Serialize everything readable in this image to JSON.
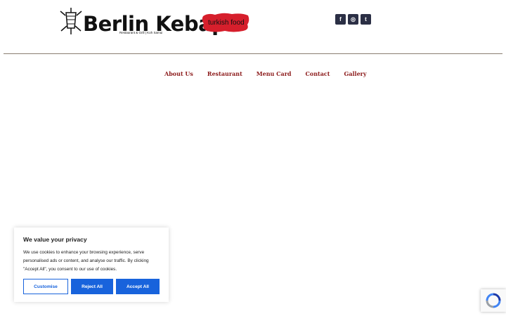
{
  "header": {
    "brand_name": "Berlin Kebap",
    "tagline": "Restaurant & Grill | Koh Samui",
    "badge_text": "turkish food",
    "badge_color": "#d61f2c"
  },
  "social": [
    {
      "icon": "facebook-icon",
      "glyph": "f"
    },
    {
      "icon": "instagram-icon",
      "glyph": "◎"
    },
    {
      "icon": "tumblr-icon",
      "glyph": "t"
    }
  ],
  "nav": {
    "items": [
      "About Us",
      "Restaurant",
      "Menu Card",
      "Contact",
      "Gallery"
    ],
    "color": "#8c1b1b"
  },
  "cookie_banner": {
    "title": "We value your privacy",
    "body": "We use cookies to enhance your browsing experience, serve personalised ads or content, and analyse our traffic. By clicking \"Accept All\", you consent to our use of cookies.",
    "customise_label": "Customise",
    "reject_label": "Reject All",
    "accept_label": "Accept All",
    "accent_color": "#1863dc"
  },
  "recaptcha": {
    "icon": "recaptcha-icon"
  }
}
